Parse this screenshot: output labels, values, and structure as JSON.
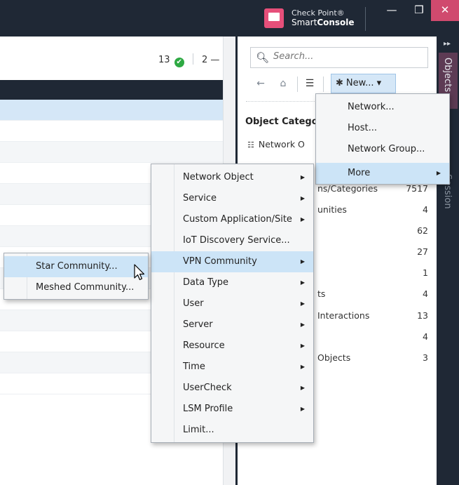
{
  "app": {
    "brand_line1": "Check Point®",
    "brand_line2_light": "Smart",
    "brand_line2_bold": "Console",
    "window_buttons": {
      "minimize": "—",
      "restore": "❒",
      "close": "✕"
    }
  },
  "left_panel": {
    "ok_count": "13",
    "ok_symbol": "✔",
    "warn_count": "2",
    "warn_symbol": "—"
  },
  "right_panel": {
    "search_placeholder": "Search...",
    "toolbar": {
      "back_icon": "←",
      "home_icon": "⌂",
      "list_icon": "☰",
      "new_label": "New...",
      "new_star": "✱",
      "new_caret": "▾"
    },
    "categories_title": "Object Categor",
    "categories": [
      {
        "label": "Network O",
        "count": ""
      },
      {
        "label": "ns/Categories",
        "count": "7517"
      },
      {
        "label": "unities",
        "count": "4"
      },
      {
        "label": "",
        "count": "62"
      },
      {
        "label": "",
        "count": "27"
      },
      {
        "label": "",
        "count": "1"
      },
      {
        "label": "ts",
        "count": "4"
      },
      {
        "label": "Interactions",
        "count": "13"
      },
      {
        "label": "",
        "count": "4"
      },
      {
        "label": "Objects",
        "count": "3"
      }
    ]
  },
  "side_tabs": {
    "objects": "Objects",
    "session": "Session",
    "chevron": "▸▸"
  },
  "new_menu": {
    "items": [
      "Network...",
      "Host...",
      "Network Group...",
      "More"
    ]
  },
  "more_menu": {
    "items": [
      "Network Object",
      "Service",
      "Custom Application/Site",
      "IoT Discovery Service...",
      "VPN Community",
      "Data Type",
      "User",
      "Server",
      "Resource",
      "Time",
      "UserCheck",
      "LSM Profile",
      "Limit..."
    ]
  },
  "vpn_menu": {
    "items": [
      "Star Community...",
      "Meshed Community..."
    ]
  },
  "submenu_arrow": "▶"
}
